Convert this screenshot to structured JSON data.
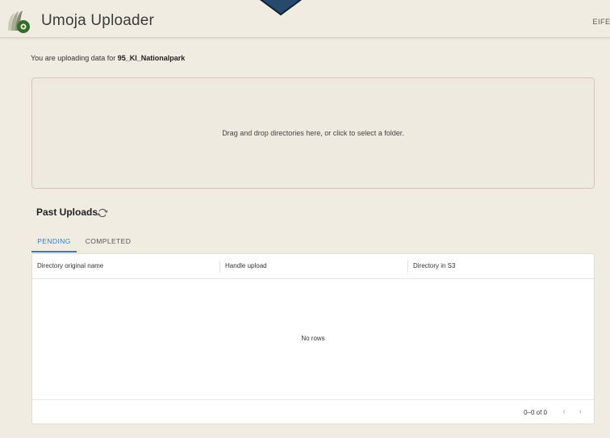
{
  "header": {
    "app_title": "Umoja Uploader",
    "user_label": "EIFEL"
  },
  "intro": {
    "prefix": "You are uploading data for ",
    "project": "95_KI_Nationalpark"
  },
  "dropzone": {
    "text": "Drag and drop directories here, or click to select a folder."
  },
  "past_uploads": {
    "title": "Past Uploads",
    "refresh_icon": "refresh-icon"
  },
  "tabs": [
    {
      "label": "PENDING",
      "active": true
    },
    {
      "label": "COMPLETED",
      "active": false
    }
  ],
  "table": {
    "columns": [
      "Directory original name",
      "Handle upload",
      "Directory in S3"
    ],
    "rows": [],
    "empty_text": "No rows",
    "pagination": "0–0 of 0"
  },
  "colors": {
    "background": "#f1ece2",
    "accent": "#2f7fc8",
    "pointer": "#2a4a6a",
    "logo_green": "#2e7d32"
  }
}
